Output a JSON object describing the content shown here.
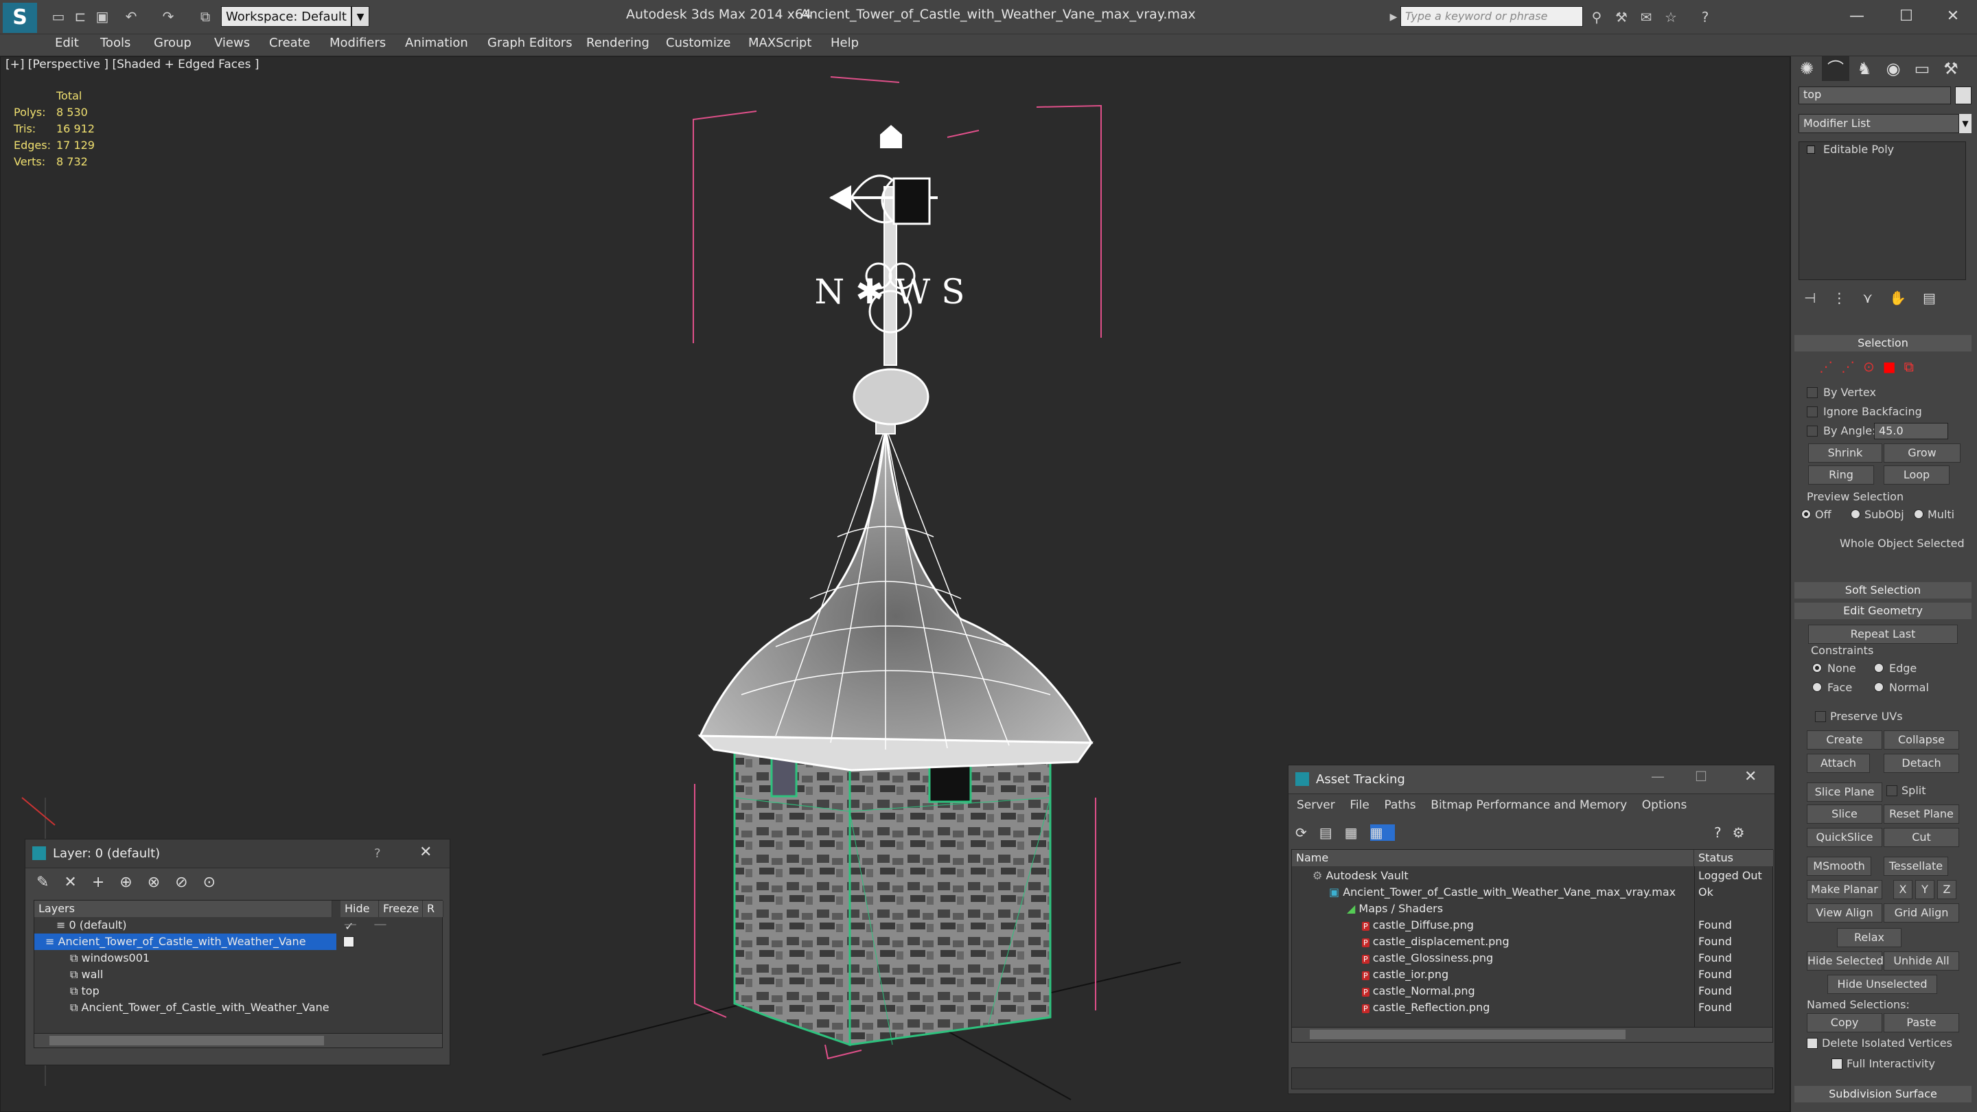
{
  "app": {
    "title": "Autodesk 3ds Max  2014 x64",
    "file": "Ancient_Tower_of_Castle_with_Weather_Vane_max_vray.max",
    "workspace": "Workspace: Default",
    "search_placeholder": "Type a keyword or phrase"
  },
  "menu": [
    "Edit",
    "Tools",
    "Group",
    "Views",
    "Create",
    "Modifiers",
    "Animation",
    "Graph Editors",
    "Rendering",
    "Customize",
    "MAXScript",
    "Help"
  ],
  "viewport": {
    "label": "[+] [Perspective ] [Shaded + Edged Faces ]",
    "stats": {
      "header": "Total",
      "rows": [
        {
          "label": "Polys:",
          "value": "8 530"
        },
        {
          "label": "Tris:",
          "value": "16 912"
        },
        {
          "label": "Edges:",
          "value": "17 129"
        },
        {
          "label": "Verts:",
          "value": "8 732"
        }
      ]
    },
    "vane_letters": "N ✱ W S",
    "accent_wire": "#ffffff",
    "selection_color": "#2ec27e",
    "bbox_color": "#e0508a"
  },
  "command_panel": {
    "object_name": "top",
    "modifier_list": "Modifier List",
    "stack": [
      "Editable Poly"
    ],
    "selection": {
      "header": "Selection",
      "by_vertex": "By Vertex",
      "ignore_backfacing": "Ignore Backfacing",
      "by_angle": "By Angle:",
      "angle_value": "45.0",
      "shrink": "Shrink",
      "grow": "Grow",
      "ring": "Ring",
      "loop": "Loop",
      "preview": "Preview Selection",
      "preview_opts": [
        "Off",
        "SubObj",
        "Multi"
      ],
      "status": "Whole Object Selected"
    },
    "soft_selection": "Soft Selection",
    "edit_geometry": {
      "header": "Edit Geometry",
      "repeat_last": "Repeat Last",
      "constraints": "Constraints",
      "constraint_opts": [
        "None",
        "Edge",
        "Face",
        "Normal"
      ],
      "preserve_uvs": "Preserve UVs",
      "create": "Create",
      "collapse": "Collapse",
      "attach": "Attach",
      "detach": "Detach",
      "slice_plane": "Slice Plane",
      "split": "Split",
      "slice": "Slice",
      "reset_plane": "Reset Plane",
      "quickslice": "QuickSlice",
      "cut": "Cut",
      "msmooth": "MSmooth",
      "tessellate": "Tessellate",
      "make_planar": "Make Planar",
      "x": "X",
      "y": "Y",
      "z": "Z",
      "view_align": "View Align",
      "grid_align": "Grid Align",
      "relax": "Relax",
      "hide_selected": "Hide Selected",
      "unhide_all": "Unhide All",
      "hide_unselected": "Hide Unselected",
      "named_selections": "Named Selections:",
      "copy": "Copy",
      "paste": "Paste",
      "delete_isolated": "Delete Isolated Vertices",
      "full_interactivity": "Full Interactivity"
    },
    "subdivision_surface": "Subdivision Surface"
  },
  "layer_window": {
    "title": "Layer: 0 (default)",
    "help": "?",
    "columns": [
      "Layers",
      "Hide",
      "Freeze",
      "R"
    ],
    "rows": [
      {
        "name": "0 (default)",
        "indent": 1
      },
      {
        "name": "Ancient_Tower_of_Castle_with_Weather_Vane",
        "indent": 0,
        "selected": true
      },
      {
        "name": "windows001",
        "indent": 2
      },
      {
        "name": "wall",
        "indent": 2
      },
      {
        "name": "top",
        "indent": 2
      },
      {
        "name": "Ancient_Tower_of_Castle_with_Weather_Vane",
        "indent": 2
      }
    ]
  },
  "asset_tracking": {
    "title": "Asset Tracking",
    "menu": [
      "Server",
      "File",
      "Paths",
      "Bitmap Performance and Memory",
      "Options"
    ],
    "columns": [
      "Name",
      "Status"
    ],
    "rows": [
      {
        "name": "Autodesk Vault",
        "status": "Logged Out",
        "indent": 0,
        "icon": "vault"
      },
      {
        "name": "Ancient_Tower_of_Castle_with_Weather_Vane_max_vray.max",
        "status": "Ok",
        "indent": 1,
        "icon": "max"
      },
      {
        "name": "Maps / Shaders",
        "status": "",
        "indent": 2,
        "icon": "folder"
      },
      {
        "name": "castle_Diffuse.png",
        "status": "Found",
        "indent": 3,
        "icon": "png"
      },
      {
        "name": "castle_displacement.png",
        "status": "Found",
        "indent": 3,
        "icon": "png"
      },
      {
        "name": "castle_Glossiness.png",
        "status": "Found",
        "indent": 3,
        "icon": "png"
      },
      {
        "name": "castle_ior.png",
        "status": "Found",
        "indent": 3,
        "icon": "png"
      },
      {
        "name": "castle_Normal.png",
        "status": "Found",
        "indent": 3,
        "icon": "png"
      },
      {
        "name": "castle_Reflection.png",
        "status": "Found",
        "indent": 3,
        "icon": "png"
      }
    ]
  }
}
